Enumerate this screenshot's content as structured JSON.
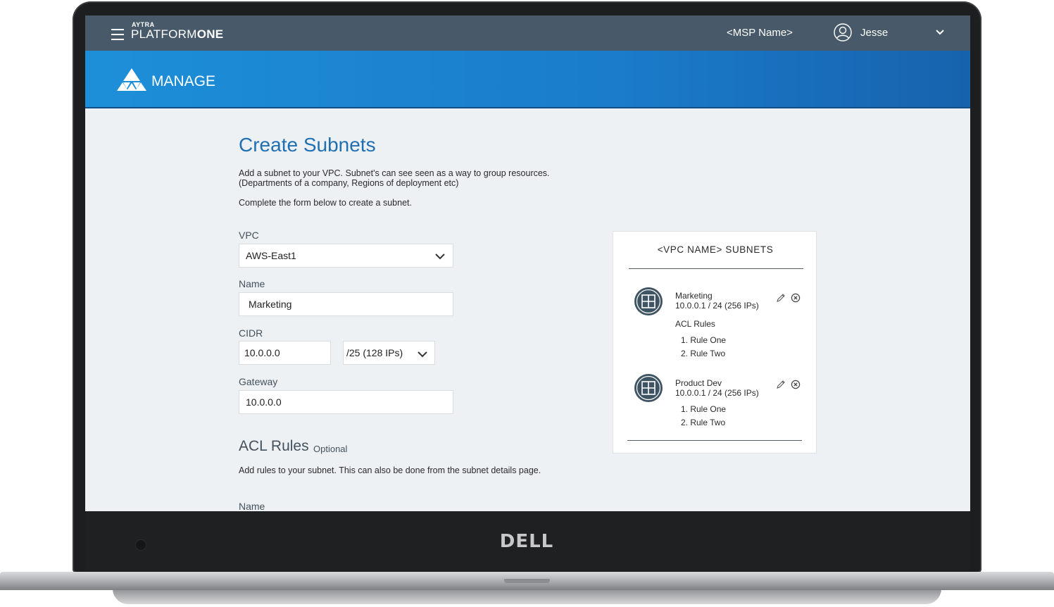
{
  "header": {
    "logo_small": "AYTRA",
    "logo_main_a": "PLATFORM",
    "logo_main_b": "ONE",
    "msp_name": "<MSP Name>",
    "user_name": "Jesse"
  },
  "banner": {
    "title": "MANAGE"
  },
  "device": {
    "brand": "DELL"
  },
  "form": {
    "title": "Create Subnets",
    "desc_line1": "Add a subnet to your VPC. Subnet's can see seen as a way to group resources.",
    "desc_line2": "(Departments of a company, Regions of deployment etc)",
    "desc_line3": "Complete the form below to create a subnet.",
    "vpc_label": "VPC",
    "vpc_value": "AWS-East1",
    "name_label": "Name",
    "name_value": "Marketing",
    "cidr_label": "CIDR",
    "cidr_ip_value": "10.0.0.0",
    "cidr_mask_value": "/25 (128 IPs)",
    "gateway_label": "Gateway",
    "gateway_value": "10.0.0.0",
    "acl_title": "ACL Rules",
    "acl_optional": "Optional",
    "acl_desc": "Add rules to your subnet. This can also be done from the subnet details page.",
    "acl_name_label": "Name"
  },
  "panel": {
    "title": "<VPC NAME> SUBNETS",
    "subnets": [
      {
        "name": "Marketing",
        "cidr": "10.0.0.1 / 24  (256 IPs)",
        "acl_heading": "ACL Rules",
        "rules": [
          "1. Rule One",
          "2. Rule Two"
        ]
      },
      {
        "name": "Product Dev",
        "cidr": "10.0.0.1 / 24  (256 IPs)",
        "rules": [
          "1. Rule One",
          "2. Rule Two"
        ]
      }
    ]
  },
  "colors": {
    "topbar": "#485a69",
    "banner": "#1a7ccb",
    "title_blue": "#1f6fb2",
    "page_bg": "#eef1f4"
  },
  "icons": [
    "hamburger-icon",
    "user-avatar-icon",
    "chevron-down-icon",
    "manage-logo-icon",
    "subnet-grid-icon",
    "edit-pencil-icon",
    "delete-circle-x-icon"
  ]
}
